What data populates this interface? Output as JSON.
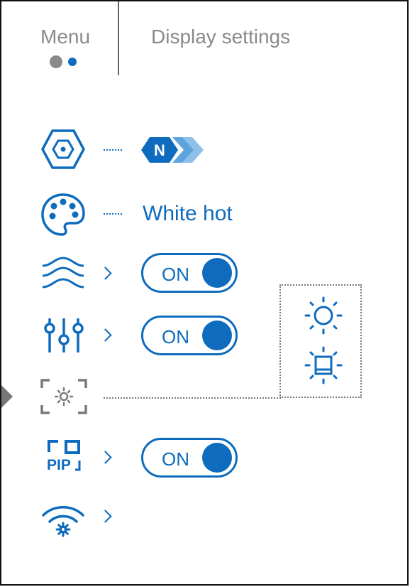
{
  "header": {
    "menu_label": "Menu",
    "title": "Display settings",
    "page_indicator": {
      "pages": 2,
      "active": 2
    }
  },
  "colors": {
    "accent": "#0e6bbd",
    "muted": "#8a8a8a"
  },
  "rows": [
    {
      "icon": "hexagon-mode-icon",
      "badge_letter": "N",
      "value": ""
    },
    {
      "icon": "palette-icon",
      "value": "White hot"
    },
    {
      "icon": "waves-icon",
      "toggle": "ON"
    },
    {
      "icon": "sliders-icon",
      "toggle": "ON"
    },
    {
      "icon": "brightness-frame-icon",
      "value": ""
    },
    {
      "icon": "pip-icon",
      "pip_label": "PIP",
      "toggle": "ON"
    },
    {
      "icon": "wifi-settings-icon"
    }
  ],
  "mode_options": [
    "sun-icon",
    "display-brightness-icon"
  ]
}
